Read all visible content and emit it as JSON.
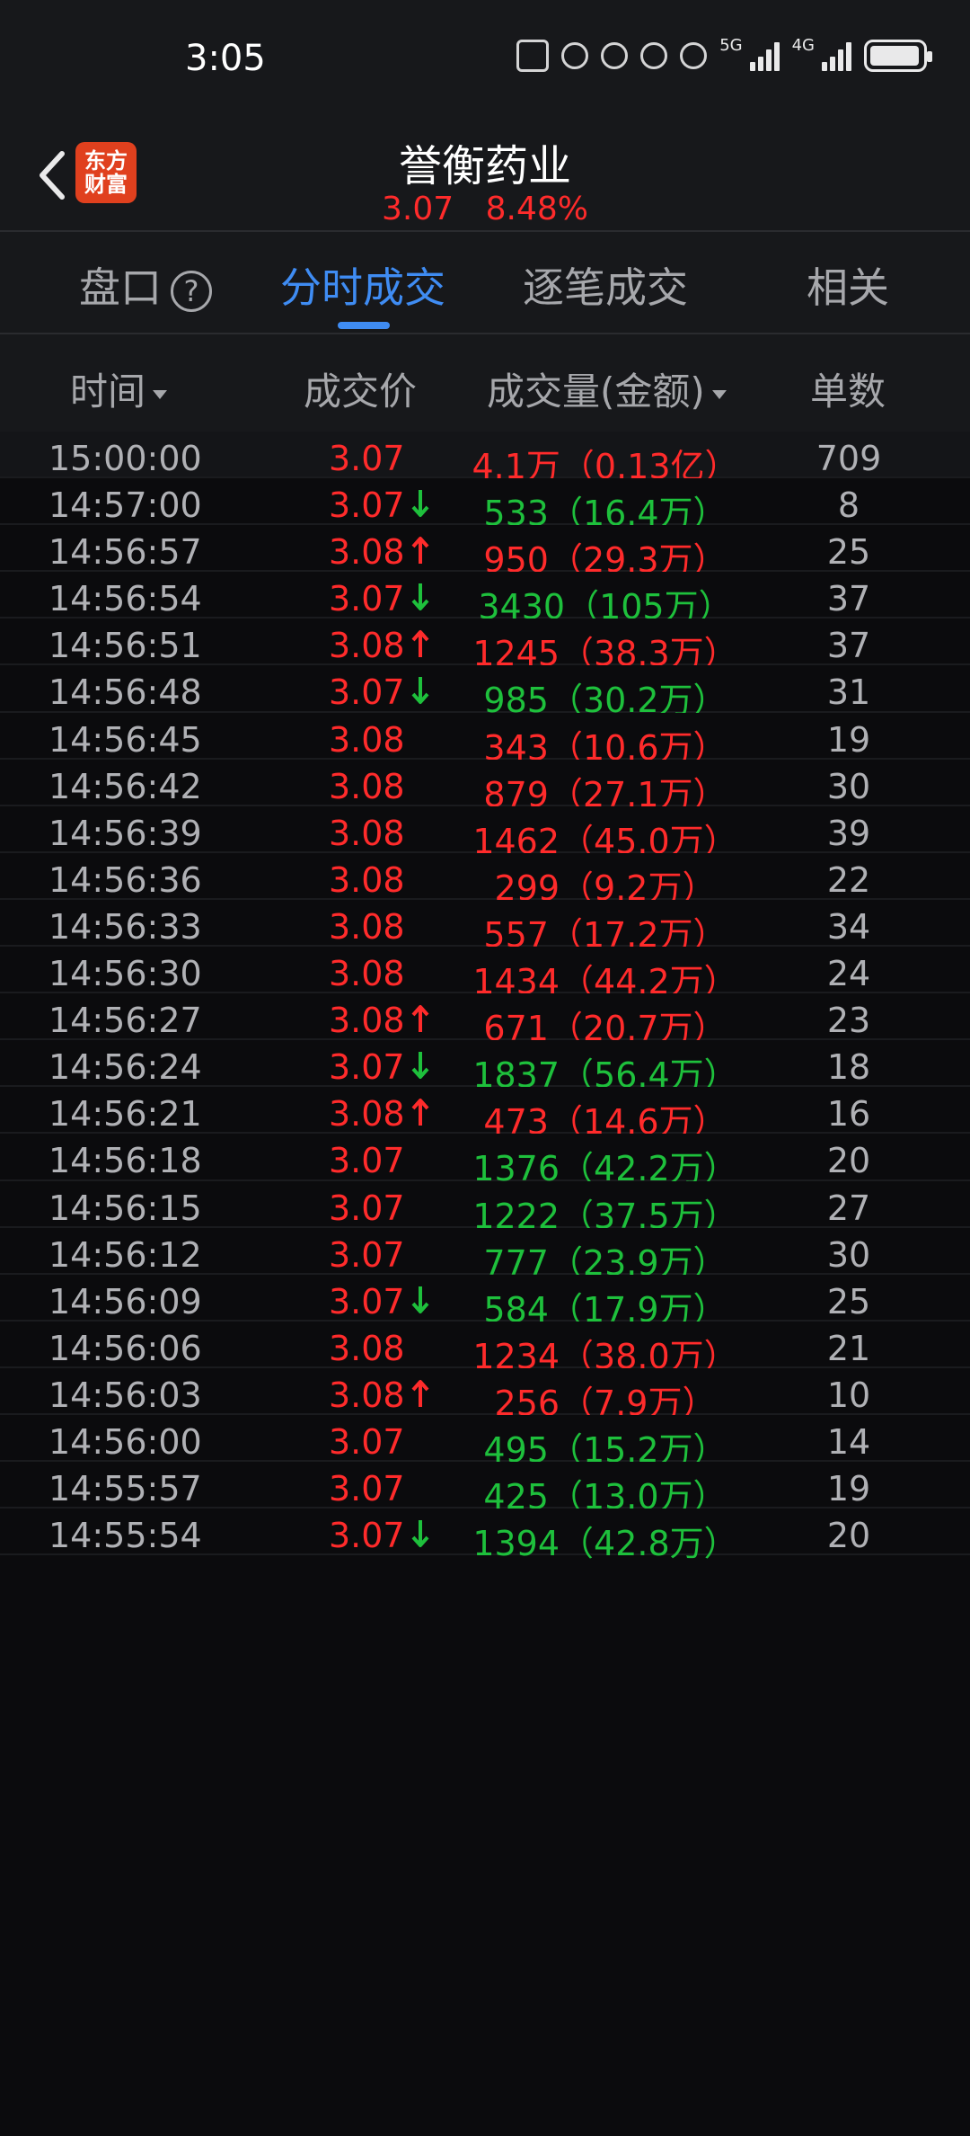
{
  "status": {
    "time": "3:05",
    "network": "5G",
    "network2": "4G"
  },
  "header": {
    "title": "誉衡药业",
    "price": "3.07",
    "change": "8.48%",
    "logo_text": "东方\n财富"
  },
  "tabs": {
    "pankou": "盘口",
    "help": "?",
    "fenshi": "分时成交",
    "zhubi": "逐笔成交",
    "xiangguan": "相关"
  },
  "columns": {
    "time": "时间",
    "price": "成交价",
    "volume": "成交量(金额)",
    "count": "单数"
  },
  "colors": {
    "red": "#ff2b2b",
    "green": "#1ec03c",
    "accent": "#3f8cf3"
  },
  "rows": [
    {
      "time": "15:00:00",
      "price": "3.07",
      "arrow": "",
      "vol": "4.1万（0.13亿）",
      "count": "709",
      "pc": "red",
      "vc": "red"
    },
    {
      "time": "14:57:00",
      "price": "3.07",
      "arrow": "down",
      "vol": "533（16.4万）",
      "count": "8",
      "pc": "red",
      "vc": "green"
    },
    {
      "time": "14:56:57",
      "price": "3.08",
      "arrow": "up",
      "vol": "950（29.3万）",
      "count": "25",
      "pc": "red",
      "vc": "red"
    },
    {
      "time": "14:56:54",
      "price": "3.07",
      "arrow": "down",
      "vol": "3430（105万）",
      "count": "37",
      "pc": "red",
      "vc": "green"
    },
    {
      "time": "14:56:51",
      "price": "3.08",
      "arrow": "up",
      "vol": "1245（38.3万）",
      "count": "37",
      "pc": "red",
      "vc": "red"
    },
    {
      "time": "14:56:48",
      "price": "3.07",
      "arrow": "down",
      "vol": "985（30.2万）",
      "count": "31",
      "pc": "red",
      "vc": "green"
    },
    {
      "time": "14:56:45",
      "price": "3.08",
      "arrow": "",
      "vol": "343（10.6万）",
      "count": "19",
      "pc": "red",
      "vc": "red"
    },
    {
      "time": "14:56:42",
      "price": "3.08",
      "arrow": "",
      "vol": "879（27.1万）",
      "count": "30",
      "pc": "red",
      "vc": "red"
    },
    {
      "time": "14:56:39",
      "price": "3.08",
      "arrow": "",
      "vol": "1462（45.0万）",
      "count": "39",
      "pc": "red",
      "vc": "red"
    },
    {
      "time": "14:56:36",
      "price": "3.08",
      "arrow": "",
      "vol": "299（9.2万）",
      "count": "22",
      "pc": "red",
      "vc": "red"
    },
    {
      "time": "14:56:33",
      "price": "3.08",
      "arrow": "",
      "vol": "557（17.2万）",
      "count": "34",
      "pc": "red",
      "vc": "red"
    },
    {
      "time": "14:56:30",
      "price": "3.08",
      "arrow": "",
      "vol": "1434（44.2万）",
      "count": "24",
      "pc": "red",
      "vc": "red"
    },
    {
      "time": "14:56:27",
      "price": "3.08",
      "arrow": "up",
      "vol": "671（20.7万）",
      "count": "23",
      "pc": "red",
      "vc": "red"
    },
    {
      "time": "14:56:24",
      "price": "3.07",
      "arrow": "down",
      "vol": "1837（56.4万）",
      "count": "18",
      "pc": "red",
      "vc": "green"
    },
    {
      "time": "14:56:21",
      "price": "3.08",
      "arrow": "up",
      "vol": "473（14.6万）",
      "count": "16",
      "pc": "red",
      "vc": "red"
    },
    {
      "time": "14:56:18",
      "price": "3.07",
      "arrow": "",
      "vol": "1376（42.2万）",
      "count": "20",
      "pc": "red",
      "vc": "green"
    },
    {
      "time": "14:56:15",
      "price": "3.07",
      "arrow": "",
      "vol": "1222（37.5万）",
      "count": "27",
      "pc": "red",
      "vc": "green"
    },
    {
      "time": "14:56:12",
      "price": "3.07",
      "arrow": "",
      "vol": "777（23.9万）",
      "count": "30",
      "pc": "red",
      "vc": "green"
    },
    {
      "time": "14:56:09",
      "price": "3.07",
      "arrow": "down",
      "vol": "584（17.9万）",
      "count": "25",
      "pc": "red",
      "vc": "green"
    },
    {
      "time": "14:56:06",
      "price": "3.08",
      "arrow": "",
      "vol": "1234（38.0万）",
      "count": "21",
      "pc": "red",
      "vc": "red"
    },
    {
      "time": "14:56:03",
      "price": "3.08",
      "arrow": "up",
      "vol": "256（7.9万）",
      "count": "10",
      "pc": "red",
      "vc": "red"
    },
    {
      "time": "14:56:00",
      "price": "3.07",
      "arrow": "",
      "vol": "495（15.2万）",
      "count": "14",
      "pc": "red",
      "vc": "green"
    },
    {
      "time": "14:55:57",
      "price": "3.07",
      "arrow": "",
      "vol": "425（13.0万）",
      "count": "19",
      "pc": "red",
      "vc": "green"
    },
    {
      "time": "14:55:54",
      "price": "3.07",
      "arrow": "down",
      "vol": "1394（42.8万）",
      "count": "20",
      "pc": "red",
      "vc": "green"
    }
  ]
}
